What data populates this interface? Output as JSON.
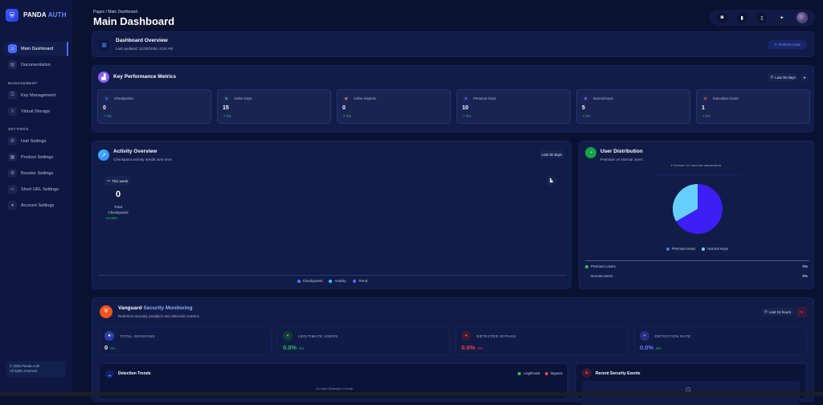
{
  "brand": {
    "name_a": "PANDA",
    "name_b": "AUTH"
  },
  "sidebar": {
    "items": [
      {
        "label": "Main Dashboard",
        "icon": "home-icon"
      },
      {
        "label": "Documentation",
        "icon": "docs-icon"
      }
    ],
    "management_label": "MANAGEMENT",
    "management": [
      {
        "label": "Key Management",
        "icon": "key-icon"
      },
      {
        "label": "Virtual Storage",
        "icon": "storage-icon"
      }
    ],
    "settings_label": "SETTINGS",
    "settings": [
      {
        "label": "Hub Settings",
        "icon": "gear-icon"
      },
      {
        "label": "Product Settings",
        "icon": "briefcase-icon"
      },
      {
        "label": "Booster Settings",
        "icon": "gear-icon"
      },
      {
        "label": "Short URL Settings",
        "icon": "link-icon"
      },
      {
        "label": "Account Settings",
        "icon": "user-icon"
      }
    ],
    "footer_line1": "© 2025 Panda Auth",
    "footer_line2": "All rights reserved"
  },
  "header": {
    "breadcrumb": "Pages / Main Dashboard",
    "title": "Main Dashboard"
  },
  "overview": {
    "title": "Dashboard Overview",
    "updated": "Last updated: 11/30/2025, 6:04 AM",
    "refresh": "Refresh Data"
  },
  "kpm": {
    "title": "Key Performance Metrics",
    "range": "Last 30 days",
    "metrics": [
      {
        "label": "Checkpoints",
        "value": "0",
        "change": "0%",
        "color": "#3b5bff"
      },
      {
        "label": "Active Keys",
        "value": "15",
        "change": "0%",
        "color": "#22c55e"
      },
      {
        "label": "Active Keyless",
        "value": "0",
        "change": "0%",
        "color": "#f59e0b"
      },
      {
        "label": "Premium Keys",
        "value": "10",
        "change": "0%",
        "color": "#6366f1"
      },
      {
        "label": "Normal Keys",
        "value": "5",
        "change": "0%",
        "color": "#a855f7"
      },
      {
        "label": "Execution Count",
        "value": "1",
        "change": "0%",
        "color": "#ef4444"
      }
    ]
  },
  "activity": {
    "title": "Activity Overview",
    "subtitle": "Checkpoint activity trends over time",
    "range": "Last 30 days",
    "period": "This week",
    "total": "0",
    "total_label1": "Total",
    "total_label2": "Checkpoints",
    "change": "+0.00%",
    "legend": [
      {
        "label": "Checkpoints",
        "color": "#3b82f6"
      },
      {
        "label": "Activity",
        "color": "#22d3ee"
      },
      {
        "label": "Trend",
        "color": "#6366f1"
      }
    ]
  },
  "distribution": {
    "title": "User Distribution",
    "subtitle": "Premium vs Normal users",
    "chart_caption": "Premium vs Normal distribution",
    "legend": [
      {
        "label": "Premium Keys",
        "color": "#3b82f6"
      },
      {
        "label": "Normal Keys",
        "color": "#7dd3fc"
      }
    ],
    "rows": [
      {
        "label": "Premium Users",
        "value": "0%"
      },
      {
        "label": "Normal Users",
        "value": "0%"
      }
    ]
  },
  "chart_data": {
    "type": "pie",
    "title": "Premium vs Normal distribution",
    "categories": [
      "Premium Keys",
      "Normal Keys"
    ],
    "values": [
      10,
      5
    ],
    "colors": [
      "#3d1ff5",
      "#67cffd"
    ]
  },
  "security": {
    "title_a": "Vanguard",
    "title_b": "Security Monitoring",
    "subtitle": "Real-time security analytics and detection metrics",
    "range": "Last 24 hours",
    "stats": [
      {
        "label": "TOTAL SESSIONS",
        "value": "0",
        "change": "0%",
        "color": "#ffffff",
        "change_color": "#22c55e",
        "icon_bg": "#2a3ea8"
      },
      {
        "label": "LEGITIMATE USERS",
        "value": "0.0%",
        "change": "0%",
        "color": "#22c55e",
        "change_color": "#22c55e",
        "icon_bg": "#163a3a"
      },
      {
        "label": "DETECTED BYPASS",
        "value": "0.0%",
        "change": "0%",
        "color": "#ef4444",
        "change_color": "#ef4444",
        "icon_bg": "#3a1a35"
      },
      {
        "label": "DETECTION RATE",
        "value": "0.0%",
        "change": "0%",
        "color": "#6d7cff",
        "change_color": "#22c55e",
        "icon_bg": "#2a2f7a"
      }
    ],
    "trends_title": "Detection Trends",
    "trends_caption": "24-Hour Detection Trends",
    "trends_legend": [
      {
        "label": "Legitimate",
        "color": "#22c55e"
      },
      {
        "label": "Bypass",
        "color": "#ef4444"
      }
    ],
    "events_title": "Recent Security Events"
  }
}
